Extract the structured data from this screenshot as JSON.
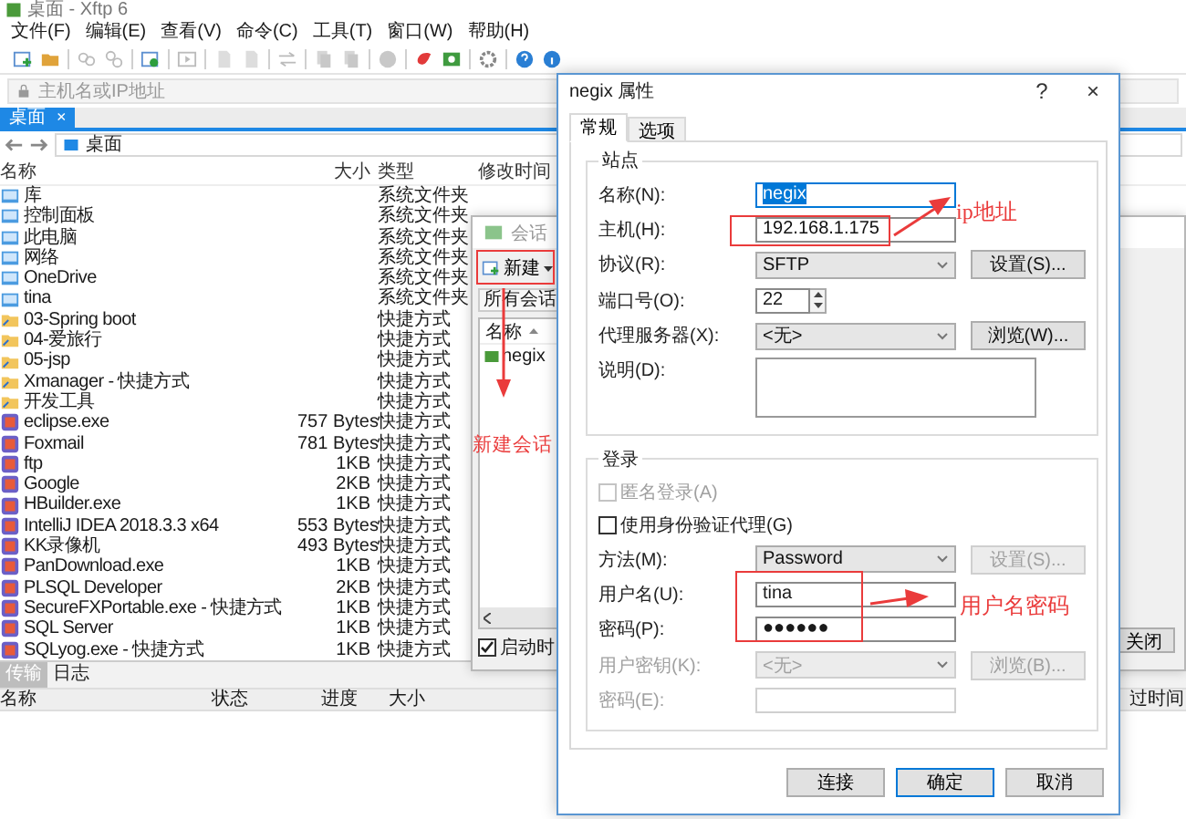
{
  "main_window": {
    "title": "桌面 - Xftp 6",
    "menu": [
      "文件(F)",
      "编辑(E)",
      "查看(V)",
      "命令(C)",
      "工具(T)",
      "窗口(W)",
      "帮助(H)"
    ],
    "address_placeholder": "主机名或IP地址",
    "tabs": [
      {
        "label": "桌面",
        "selected": true,
        "close": "×"
      }
    ],
    "path": "桌面",
    "file_columns": [
      "名称",
      "大小",
      "类型",
      "修改时间"
    ],
    "files": [
      {
        "name": "库",
        "type": "系统文件夹",
        "kind": "system_folder"
      },
      {
        "name": "控制面板",
        "type": "系统文件夹",
        "kind": "system_folder"
      },
      {
        "name": "此电脑",
        "type": "系统文件夹",
        "kind": "system_folder"
      },
      {
        "name": "网络",
        "type": "系统文件夹",
        "kind": "system_folder"
      },
      {
        "name": "OneDrive",
        "type": "系统文件夹",
        "kind": "system_folder"
      },
      {
        "name": "tina",
        "type": "系统文件夹",
        "kind": "system_folder"
      },
      {
        "name": "03-Spring boot",
        "type": "快捷方式",
        "kind": "shortcut_folder"
      },
      {
        "name": "04-爱旅行",
        "type": "快捷方式",
        "kind": "shortcut_folder"
      },
      {
        "name": "05-jsp",
        "type": "快捷方式",
        "kind": "shortcut_folder"
      },
      {
        "name": "Xmanager - 快捷方式",
        "type": "快捷方式",
        "kind": "shortcut_folder"
      },
      {
        "name": "开发工具",
        "type": "快捷方式",
        "kind": "shortcut_folder"
      },
      {
        "name": "eclipse.exe",
        "size": "757 Bytes",
        "type": "快捷方式",
        "kind": "program"
      },
      {
        "name": "Foxmail",
        "size": "781 Bytes",
        "type": "快捷方式",
        "kind": "program"
      },
      {
        "name": "ftp",
        "size": "1KB",
        "type": "快捷方式",
        "kind": "program"
      },
      {
        "name": "Google",
        "size": "2KB",
        "type": "快捷方式",
        "kind": "program"
      },
      {
        "name": "HBuilder.exe",
        "size": "1KB",
        "type": "快捷方式",
        "kind": "program"
      },
      {
        "name": "IntelliJ IDEA 2018.3.3 x64",
        "size": "553 Bytes",
        "type": "快捷方式",
        "kind": "program"
      },
      {
        "name": "KK录像机",
        "size": "493 Bytes",
        "type": "快捷方式",
        "kind": "program"
      },
      {
        "name": "PanDownload.exe",
        "size": "1KB",
        "type": "快捷方式",
        "kind": "program"
      },
      {
        "name": "PLSQL Developer",
        "size": "2KB",
        "type": "快捷方式",
        "kind": "program"
      },
      {
        "name": "SecureFXPortable.exe - 快捷方式",
        "size": "1KB",
        "type": "快捷方式",
        "kind": "program"
      },
      {
        "name": "SQL Server",
        "size": "1KB",
        "type": "快捷方式",
        "kind": "program"
      },
      {
        "name": "SQLyog.exe - 快捷方式",
        "size": "1KB",
        "type": "快捷方式",
        "kind": "program"
      }
    ],
    "transfer_tabs": [
      {
        "label": "传输",
        "selected": true
      },
      {
        "label": "日志",
        "selected": false
      }
    ],
    "transfer_columns": [
      "名称",
      "状态",
      "进度",
      "大小"
    ],
    "elapsed_column": "过时间"
  },
  "session_dialog": {
    "title": "会话",
    "new_button": "新建",
    "path": "所有会话",
    "list_column": "名称",
    "sessions": [
      "negix"
    ],
    "startup_checkbox": {
      "label": "启动时",
      "checked": true
    },
    "close_button": "关闭"
  },
  "properties_dialog": {
    "title": "negix 属性",
    "help": "?",
    "close": "×",
    "tabs": [
      {
        "label": "常规",
        "selected": true
      },
      {
        "label": "选项",
        "selected": false
      }
    ],
    "site_group": "站点",
    "site_fields": [
      {
        "kind": "text",
        "label": "名称(N):",
        "value": "negix",
        "focused": true
      },
      {
        "kind": "text",
        "label": "主机(H):",
        "value": "192.168.1.175",
        "focused": false
      },
      {
        "kind": "select",
        "label": "协议(R):",
        "value": "SFTP",
        "button": "设置(S)..."
      },
      {
        "kind": "spin",
        "label": "端口号(O):",
        "value": "22"
      },
      {
        "kind": "select",
        "label": "代理服务器(X):",
        "value": "<无>",
        "button": "浏览(W)..."
      },
      {
        "kind": "textarea",
        "label": "说明(D):"
      }
    ],
    "login_group": "登录",
    "login_fields": [
      {
        "kind": "checkbox",
        "label": "匿名登录(A)",
        "checked": false,
        "disabled": true
      },
      {
        "kind": "checkbox",
        "label": "使用身份验证代理(G)",
        "checked": false,
        "disabled": false
      },
      {
        "kind": "select",
        "label": "方法(M):",
        "value": "Password",
        "button": "设置(S)...",
        "disabled": false,
        "button_disabled": true
      },
      {
        "kind": "text",
        "label": "用户名(U):",
        "value": "tina",
        "disabled": false
      },
      {
        "kind": "text",
        "label": "密码(P):",
        "value": "●●●●●●",
        "disabled": false
      },
      {
        "kind": "select",
        "label": "用户密钥(K):",
        "value": "<无>",
        "button": "浏览(B)...",
        "disabled": true,
        "button_disabled": true
      },
      {
        "kind": "text",
        "label": "密码(E):",
        "disabled": true
      }
    ],
    "buttons": [
      {
        "label": "连接",
        "default": false
      },
      {
        "label": "确定",
        "default": true
      },
      {
        "label": "取消",
        "default": false
      }
    ]
  },
  "annotations": [
    {
      "text": "新建会话"
    },
    {
      "text": "ip地址"
    },
    {
      "text": "用户名密码"
    }
  ]
}
